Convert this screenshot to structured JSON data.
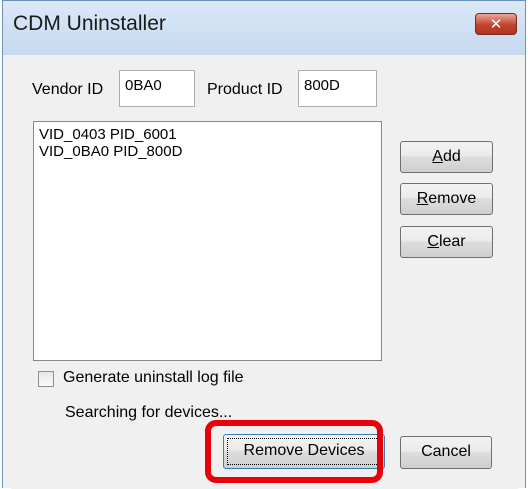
{
  "window": {
    "title": "CDM Uninstaller",
    "close_glyph": "✕"
  },
  "vendor": {
    "label": "Vendor ID",
    "value": "0BA0"
  },
  "product": {
    "label": "Product ID",
    "value": "800D"
  },
  "device_list": {
    "items": [
      "VID_0403 PID_6001",
      "VID_0BA0 PID_800D"
    ]
  },
  "buttons": {
    "add": {
      "accel": "A",
      "rest": "dd"
    },
    "remove": {
      "accel": "R",
      "rest": "emove"
    },
    "clear": {
      "accel": "C",
      "rest": "lear"
    },
    "remove_devices": "Remove Devices",
    "cancel": "Cancel"
  },
  "log_checkbox": {
    "label": "Generate uninstall log file",
    "checked": false
  },
  "status": "Searching for devices...",
  "colors": {
    "highlight": "#e8000b",
    "close_button": "#c2432d",
    "title_bar": "#c6d9f0"
  }
}
